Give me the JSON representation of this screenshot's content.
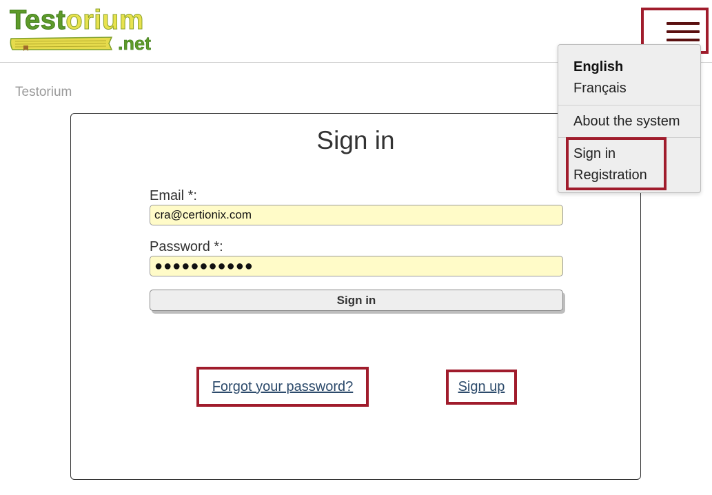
{
  "header": {
    "logo": {
      "word_part1": "Test",
      "word_part2": "orium",
      "suffix": ".net"
    },
    "menu_icon": "hamburger-menu-icon"
  },
  "breadcrumb": "Testorium",
  "login": {
    "title": "Sign in",
    "email_label": "Email *:",
    "email_value": "cra@certionix.com",
    "password_label": "Password *:",
    "password_value": "●●●●●●●●●●●",
    "submit_label": "Sign in",
    "forgot_link": "Forgot your password?",
    "signup_link": "Sign up"
  },
  "menu": {
    "languages": [
      "English",
      "Français"
    ],
    "about": "About the system",
    "account": [
      "Sign in",
      "Registration"
    ]
  },
  "colors": {
    "highlight_border": "#a01c2c",
    "input_background": "#fffbc8",
    "link": "#2c4a6b",
    "logo_green": "#5e9a2a",
    "logo_yellow": "#e8e24e"
  }
}
